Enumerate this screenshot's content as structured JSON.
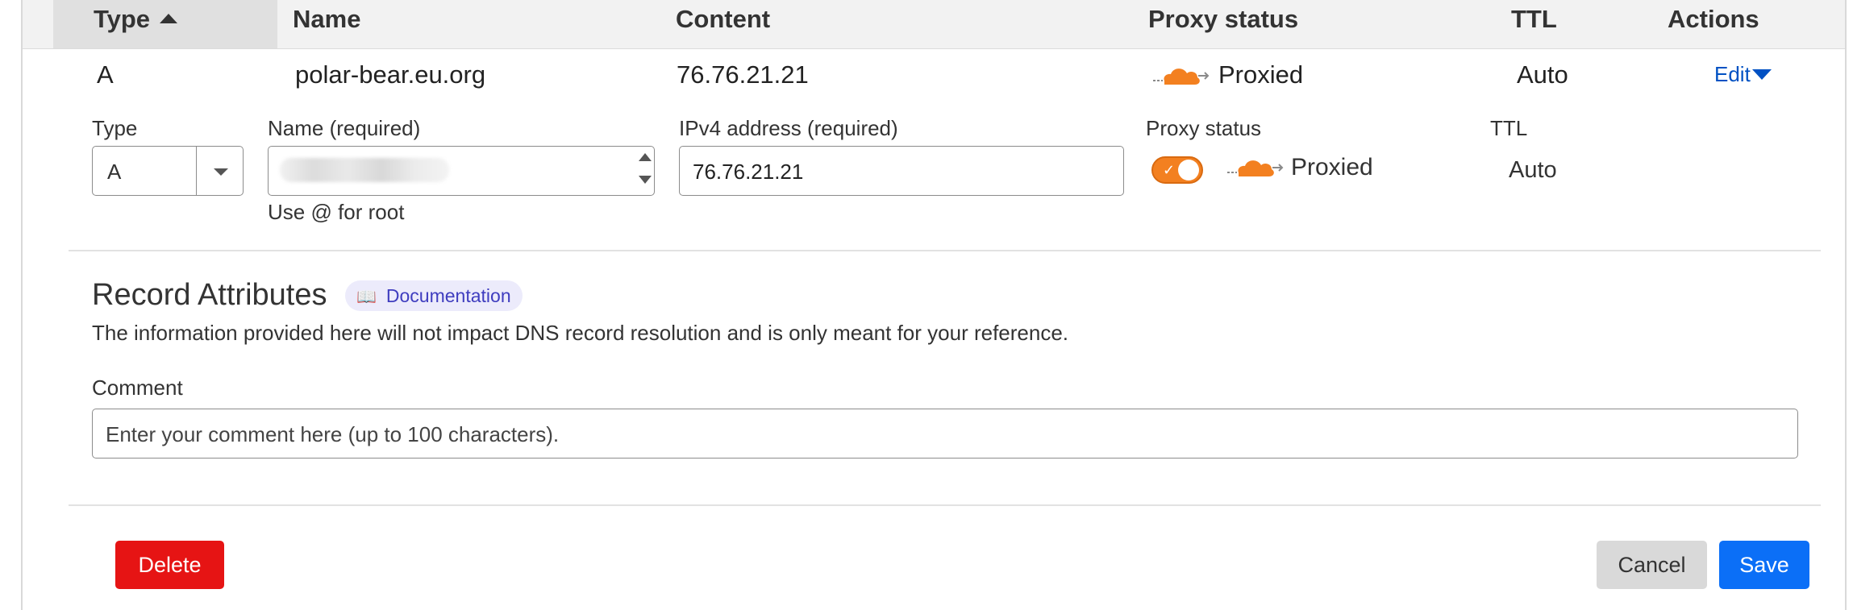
{
  "table": {
    "columns": {
      "type": "Type",
      "name": "Name",
      "content": "Content",
      "proxy_status": "Proxy status",
      "ttl": "TTL",
      "actions": "Actions"
    },
    "sorted_by": "Type",
    "record": {
      "type": "A",
      "name": "polar-bear.eu.org",
      "content": "76.76.21.21",
      "proxy_status": "Proxied",
      "ttl": "Auto",
      "action": "Edit"
    }
  },
  "edit_form": {
    "type_label": "Type",
    "type_value": "A",
    "name_label": "Name (required)",
    "name_hint": "Use @ for root",
    "ipv4_label": "IPv4 address (required)",
    "ipv4_value": "76.76.21.21",
    "proxy_label": "Proxy status",
    "proxy_value": "Proxied",
    "proxy_enabled": true,
    "ttl_label": "TTL",
    "ttl_value": "Auto"
  },
  "attributes": {
    "title": "Record Attributes",
    "doc_link": "Documentation",
    "description": "The information provided here will not impact DNS record resolution and is only meant for your reference.",
    "comment_label": "Comment",
    "comment_placeholder": "Enter your comment here (up to 100 characters)."
  },
  "buttons": {
    "delete": "Delete",
    "cancel": "Cancel",
    "save": "Save"
  },
  "colors": {
    "accent_orange": "#f38020",
    "link_blue": "#0051c3",
    "delete_red": "#e61414",
    "save_blue": "#0b6ff7",
    "doc_badge_bg": "#ecebfb"
  },
  "icons": {
    "proxy": "cloud-icon",
    "doc": "book-icon",
    "sort": "sort-ascending-icon"
  }
}
